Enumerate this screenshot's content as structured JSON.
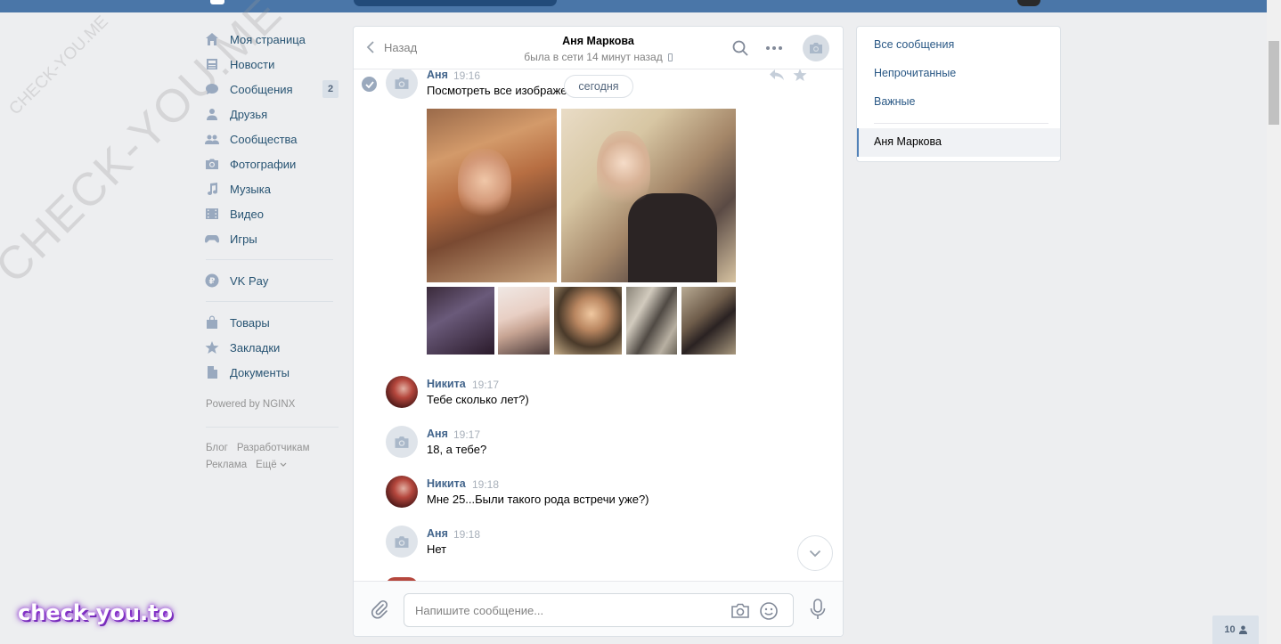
{
  "watermark": {
    "main": "CHECK-YOU.ME",
    "small": "CHECK-YOU.ME",
    "brand": "check-you.to"
  },
  "nav": {
    "items": [
      {
        "label": "Моя страница",
        "icon": "home-icon"
      },
      {
        "label": "Новости",
        "icon": "news-icon"
      },
      {
        "label": "Сообщения",
        "icon": "messages-icon",
        "badge": "2"
      },
      {
        "label": "Друзья",
        "icon": "friends-icon"
      },
      {
        "label": "Сообщества",
        "icon": "groups-icon"
      },
      {
        "label": "Фотографии",
        "icon": "photos-icon"
      },
      {
        "label": "Музыка",
        "icon": "music-icon"
      },
      {
        "label": "Видео",
        "icon": "video-icon"
      },
      {
        "label": "Игры",
        "icon": "games-icon"
      }
    ],
    "vkpay": {
      "label": "VK Pay",
      "icon": "vkpay-icon"
    },
    "extra": [
      {
        "label": "Товары",
        "icon": "market-icon"
      },
      {
        "label": "Закладки",
        "icon": "bookmarks-icon"
      },
      {
        "label": "Документы",
        "icon": "documents-icon"
      }
    ],
    "powered": "Powered by NGINX",
    "footer": {
      "blog": "Блог",
      "dev": "Разработчикам",
      "ads": "Реклама",
      "more": "Ещё"
    }
  },
  "chat": {
    "back_label": "Назад",
    "peer_name": "Аня Маркова",
    "peer_status": "была в сети 14 минут назад",
    "date_pill": "сегодня",
    "messages": [
      {
        "author": "Аня",
        "time": "19:16",
        "text": "Посмотреть все изображения"
      },
      {
        "author": "Никита",
        "time": "19:17",
        "text": "Тебе сколько лет?)"
      },
      {
        "author": "Аня",
        "time": "19:17",
        "text": "18, а тебе?"
      },
      {
        "author": "Никита",
        "time": "19:18",
        "text": "Мне 25...Были такого рода встречи уже?)"
      },
      {
        "author": "Аня",
        "time": "19:18",
        "text": "Нет"
      }
    ],
    "composer_placeholder": "Напишите сообщение..."
  },
  "filters": {
    "all": "Все сообщения",
    "unread": "Непрочитанные",
    "important": "Важные",
    "active": "Аня Маркова"
  },
  "online_count": "10",
  "colors": {
    "header": "#4a76a8",
    "link": "#2a5885",
    "author": "#42648b",
    "bg": "#edeef0"
  }
}
